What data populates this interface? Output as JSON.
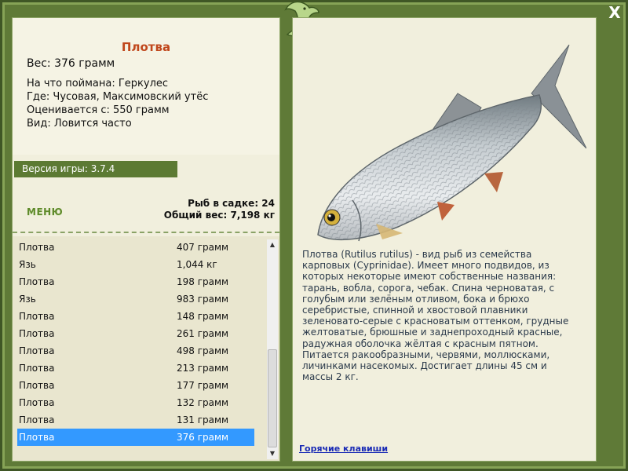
{
  "window": {
    "close_glyph": "X"
  },
  "fish": {
    "name": "Плотва",
    "weight": "Вес: 376 грамм",
    "bait": "На что поймана: Геркулес",
    "place": "Где: Чусовая, Максимовский утёс",
    "value": "Оценивается с: 550 грамм",
    "type": "Вид: Ловится часто"
  },
  "version": "Версия игры: 3.7.4",
  "menu_label": "МЕНЮ",
  "stats": {
    "count": "Рыб в садке: 24",
    "total": "Общий вес: 7,198 кг"
  },
  "catch_list": [
    {
      "name": "Плотва",
      "weight": "407 грамм"
    },
    {
      "name": "Язь",
      "weight": "1,044 кг"
    },
    {
      "name": "Плотва",
      "weight": "198 грамм"
    },
    {
      "name": "Язь",
      "weight": "983 грамм"
    },
    {
      "name": "Плотва",
      "weight": "148 грамм"
    },
    {
      "name": "Плотва",
      "weight": "261 грамм"
    },
    {
      "name": "Плотва",
      "weight": "498 грамм"
    },
    {
      "name": "Плотва",
      "weight": "213 грамм"
    },
    {
      "name": "Плотва",
      "weight": "177 грамм"
    },
    {
      "name": "Плотва",
      "weight": "132 грамм"
    },
    {
      "name": "Плотва",
      "weight": "131 грамм"
    },
    {
      "name": "Плотва",
      "weight": "376 грамм"
    }
  ],
  "description": "Плотва (Rutilus rutilus) - вид рыб из семейства карповых (Cyprinidae). Имеет много подвидов, из которых некоторые имеют собственные названия: тарань, вобла, сорога, чебак. Спина черноватая, с голубым или зелёным отливом, бока и брюхо серебристые, спинной и хвостовой плавники зеленовато-серые с красноватым оттенком, грудные желтоватые, брюшные и заднепроходный красные, радужная оболочка жёлтая с красным пятном. Питается ракообразными, червями, моллюсками, личинками насекомых. Достигает длины 45 см и массы 2 кг.",
  "hotkeys_label": "Горячие клавиши",
  "colors": {
    "frame": "#5f7a37",
    "panel": "#f1efdd",
    "selected": "#3399ff",
    "title": "#c0471c"
  }
}
